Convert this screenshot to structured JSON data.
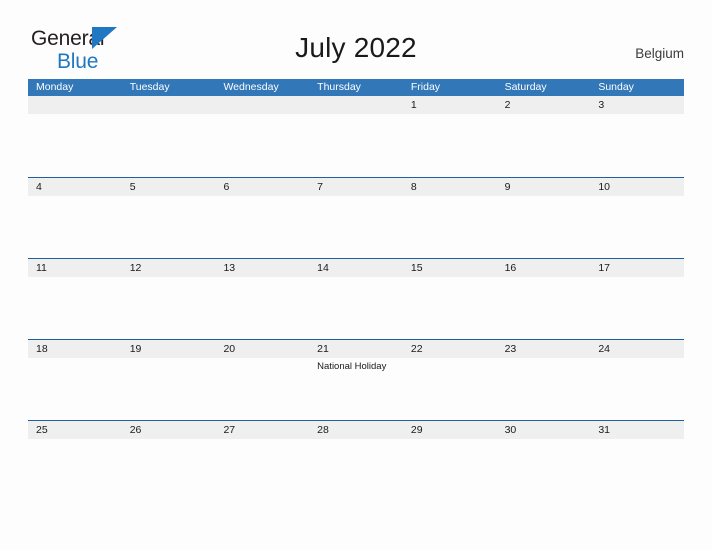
{
  "brand": {
    "name_part1": "General",
    "name_part2": "Blue",
    "flag_icon": "triangle-flag-icon",
    "color_primary": "#1f78c1",
    "color_text": "#231f20"
  },
  "header": {
    "title": "July 2022",
    "country": "Belgium"
  },
  "calendar": {
    "header_bg": "#3277b8",
    "band_bg": "#efefef",
    "rule_color": "#1f5fa0",
    "weekday_headers": [
      "Monday",
      "Tuesday",
      "Wednesday",
      "Thursday",
      "Friday",
      "Saturday",
      "Sunday"
    ],
    "weeks": [
      {
        "days": [
          {
            "num": "",
            "event": ""
          },
          {
            "num": "",
            "event": ""
          },
          {
            "num": "",
            "event": ""
          },
          {
            "num": "",
            "event": ""
          },
          {
            "num": "1",
            "event": ""
          },
          {
            "num": "2",
            "event": ""
          },
          {
            "num": "3",
            "event": ""
          }
        ]
      },
      {
        "days": [
          {
            "num": "4",
            "event": ""
          },
          {
            "num": "5",
            "event": ""
          },
          {
            "num": "6",
            "event": ""
          },
          {
            "num": "7",
            "event": ""
          },
          {
            "num": "8",
            "event": ""
          },
          {
            "num": "9",
            "event": ""
          },
          {
            "num": "10",
            "event": ""
          }
        ]
      },
      {
        "days": [
          {
            "num": "11",
            "event": ""
          },
          {
            "num": "12",
            "event": ""
          },
          {
            "num": "13",
            "event": ""
          },
          {
            "num": "14",
            "event": ""
          },
          {
            "num": "15",
            "event": ""
          },
          {
            "num": "16",
            "event": ""
          },
          {
            "num": "17",
            "event": ""
          }
        ]
      },
      {
        "days": [
          {
            "num": "18",
            "event": ""
          },
          {
            "num": "19",
            "event": ""
          },
          {
            "num": "20",
            "event": ""
          },
          {
            "num": "21",
            "event": "National Holiday"
          },
          {
            "num": "22",
            "event": ""
          },
          {
            "num": "23",
            "event": ""
          },
          {
            "num": "24",
            "event": ""
          }
        ]
      },
      {
        "days": [
          {
            "num": "25",
            "event": ""
          },
          {
            "num": "26",
            "event": ""
          },
          {
            "num": "27",
            "event": ""
          },
          {
            "num": "28",
            "event": ""
          },
          {
            "num": "29",
            "event": ""
          },
          {
            "num": "30",
            "event": ""
          },
          {
            "num": "31",
            "event": ""
          }
        ]
      }
    ]
  }
}
